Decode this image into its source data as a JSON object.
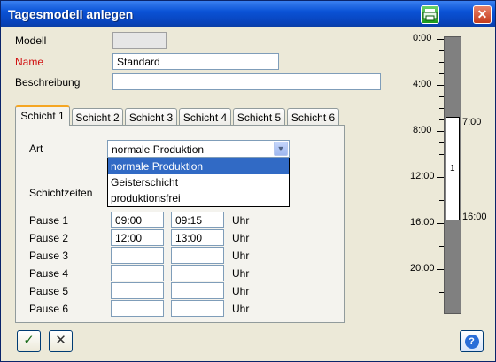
{
  "window": {
    "title": "Tagesmodell anlegen",
    "close_glyph": "✕",
    "print_icon": "printer-icon"
  },
  "form": {
    "modell_label": "Modell",
    "modell_value": "",
    "name_label": "Name",
    "name_value": "Standard",
    "beschreibung_label": "Beschreibung",
    "beschreibung_value": ""
  },
  "tabs": [
    "Schicht 1",
    "Schicht 2",
    "Schicht 3",
    "Schicht 4",
    "Schicht 5",
    "Schicht 6"
  ],
  "tab_panel": {
    "art_label": "Art",
    "art_value": "normale Produktion",
    "art_options": [
      "normale Produktion",
      "Geisterschicht",
      "produktionsfrei"
    ],
    "schichtzeiten_label": "Schichtzeiten",
    "unit": "Uhr",
    "pauses": [
      {
        "label": "Pause 1",
        "start": "09:00",
        "end": "09:15"
      },
      {
        "label": "Pause 2",
        "start": "12:00",
        "end": "13:00"
      },
      {
        "label": "Pause 3",
        "start": "",
        "end": ""
      },
      {
        "label": "Pause 4",
        "start": "",
        "end": ""
      },
      {
        "label": "Pause 5",
        "start": "",
        "end": ""
      },
      {
        "label": "Pause 6",
        "start": "",
        "end": ""
      }
    ]
  },
  "timeline": {
    "hour_labels": [
      "0:00",
      "4:00",
      "8:00",
      "12:00",
      "16:00",
      "20:00"
    ],
    "shift_label": "1",
    "shift_start": "7:00",
    "shift_end": "16:00"
  },
  "buttons": {
    "ok_glyph": "✓",
    "cancel_glyph": "✕",
    "help_glyph": "?"
  },
  "colors": {
    "title_bar": "#0a52d6",
    "name_label": "#d01010",
    "selection": "#316ac5"
  }
}
